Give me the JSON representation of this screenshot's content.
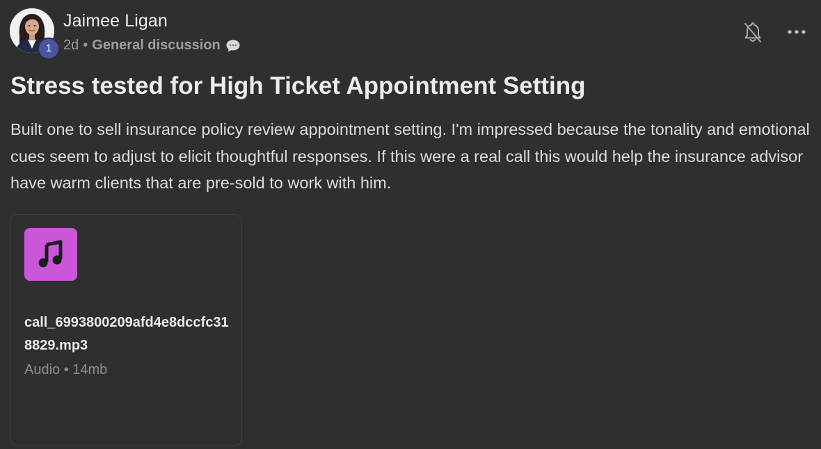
{
  "post": {
    "author": {
      "name": "Jaimee Ligan",
      "level": "1"
    },
    "time": "2d",
    "separator": "•",
    "category": "General discussion",
    "title": "Stress tested for High Ticket Appointment Setting",
    "body": "Built one to sell insurance policy review appointment setting. I'm impressed because the tonality and emotional cues seem to adjust to elicit thoughtful responses. If this were a real call this would help the insurance advisor have warm clients that are pre-sold to work with him.",
    "attachment": {
      "file_name": "call_6993800209afd4e8dccfc318829.mp3",
      "meta": "Audio • 14mb",
      "icon": "music-note-icon",
      "icon_color": "#cc56d9"
    }
  },
  "icons": {
    "bell": "bell-muted-icon",
    "more": "more-horizontal-icon",
    "chat": "speech-bubble-icon"
  },
  "colors": {
    "background": "#2f2f2f",
    "level_badge": "#4a55a8",
    "text_primary": "#ececec",
    "text_muted": "#9a9a9a"
  }
}
